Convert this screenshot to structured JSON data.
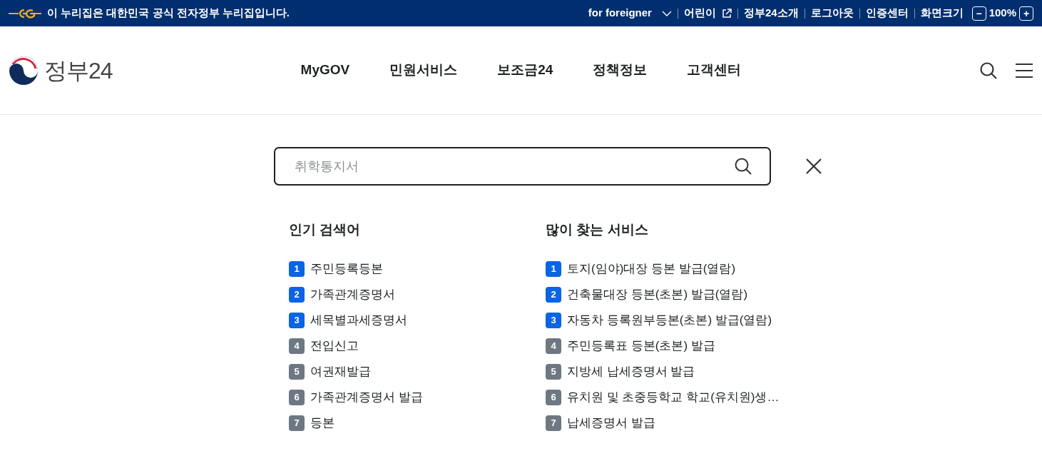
{
  "gov_banner": {
    "text": "이 누리집은 대한민국 공식 전자정부 누리집입니다."
  },
  "utility_links": [
    {
      "label": "for foreigner",
      "kind": "dropdown"
    },
    {
      "label": "어린이",
      "kind": "external"
    },
    {
      "label": "정부24소개",
      "kind": "link"
    },
    {
      "label": "로그아웃",
      "kind": "link"
    },
    {
      "label": "인증센터",
      "kind": "link"
    }
  ],
  "zoom": {
    "label": "화면크기",
    "value": "100%",
    "minus": "−",
    "plus": "+"
  },
  "logo": {
    "text": "정부24"
  },
  "nav": [
    "MyGOV",
    "민원서비스",
    "보조금24",
    "정책정보",
    "고객센터"
  ],
  "search": {
    "placeholder": "취학통지서"
  },
  "popular": {
    "title": "인기 검색어",
    "items": [
      {
        "rank": "1",
        "text": "주민등록등본",
        "highlighted": true
      },
      {
        "rank": "2",
        "text": "가족관계증명서",
        "highlighted": true
      },
      {
        "rank": "3",
        "text": "세목별과세증명서",
        "highlighted": true
      },
      {
        "rank": "4",
        "text": "전입신고",
        "highlighted": false
      },
      {
        "rank": "5",
        "text": "여권재발급",
        "highlighted": false
      },
      {
        "rank": "6",
        "text": "가족관계증명서 발급",
        "highlighted": false
      },
      {
        "rank": "7",
        "text": "등본",
        "highlighted": false
      }
    ]
  },
  "services": {
    "title": "많이 찾는 서비스",
    "items": [
      {
        "rank": "1",
        "text": "토지(임야)대장 등본 발급(열람)",
        "highlighted": true
      },
      {
        "rank": "2",
        "text": "건축물대장 등본(초본) 발급(열람)",
        "highlighted": true
      },
      {
        "rank": "3",
        "text": "자동차 등록원부등본(초본) 발급(열람)",
        "highlighted": true
      },
      {
        "rank": "4",
        "text": "주민등록표 등본(초본) 발급",
        "highlighted": false
      },
      {
        "rank": "5",
        "text": "지방세 납세증명서 발급",
        "highlighted": false
      },
      {
        "rank": "6",
        "text": "유치원 및 초중등학교 학교(유치원)생…",
        "highlighted": false
      },
      {
        "rank": "7",
        "text": "납세증명서 발급",
        "highlighted": false
      }
    ]
  }
}
